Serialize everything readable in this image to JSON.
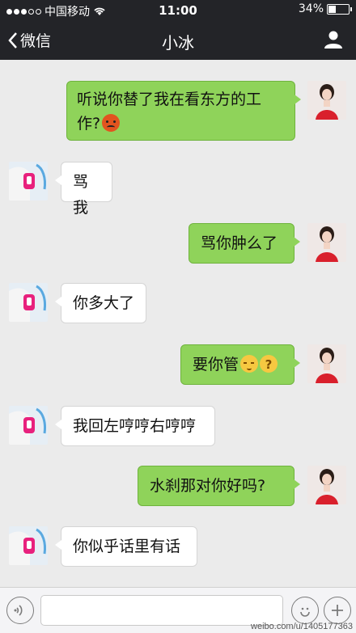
{
  "status_bar": {
    "carrier": "中国移动",
    "time": "11:00",
    "battery": "34%",
    "battery_level": 0.34
  },
  "nav": {
    "back_label": "微信",
    "title": "小冰"
  },
  "messages": [
    {
      "side": "right",
      "text": "听说你替了我在看东方的工作?",
      "emoji": "angry-face"
    },
    {
      "side": "left",
      "text": "骂我"
    },
    {
      "side": "right",
      "text": "骂你肿么了"
    },
    {
      "side": "left",
      "text": "你多大了"
    },
    {
      "side": "right",
      "text": "要你管",
      "emoji": "shy-face confused-face"
    },
    {
      "side": "left",
      "text": "我回左哼哼右哼哼"
    },
    {
      "side": "right",
      "text": "水刹那对你好吗?"
    },
    {
      "side": "left",
      "text": "你似乎话里有话"
    }
  ],
  "msg1": {
    "line1": "听说你替了我在看东方的工",
    "line2": "作?"
  },
  "watermark": "weibo.com/u/1405177363",
  "colors": {
    "header": "#232428",
    "sent_bubble": "#8fd35a",
    "received_bubble": "#ffffff",
    "chat_bg": "#ebebeb"
  }
}
